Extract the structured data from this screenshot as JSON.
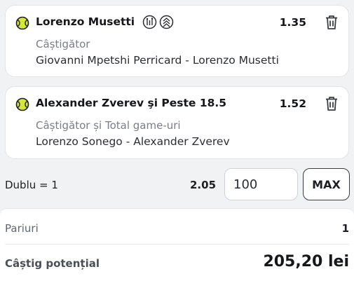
{
  "selections": [
    {
      "name": "Lorenzo Musetti",
      "odd": "1.35",
      "market": "Câștigător",
      "event": "Giovanni Mpetshi Perricard - Lorenzo Musetti",
      "sport_icon": "tennis-ball-icon",
      "badges": [
        "stats-badge-icon",
        "live-badge-icon"
      ]
    },
    {
      "name": "Alexander Zverev şi Peste 18.5",
      "odd": "1.52",
      "market": "Câștigător și Total game-uri",
      "event": "Lorenzo Sonego - Alexander Zverev",
      "sport_icon": "tennis-ball-icon"
    }
  ],
  "bet": {
    "type_label": "Dublu = 1",
    "total_odd": "2.05",
    "stake_value": "100",
    "max_label": "MAX"
  },
  "summary": {
    "bets_label": "Pariuri",
    "bets_count": "1",
    "payout_label": "Câștig potențial",
    "payout_value": "205,20 lei"
  },
  "colors": {
    "ball": "#d4e83a",
    "accent_text": "#15171a"
  }
}
